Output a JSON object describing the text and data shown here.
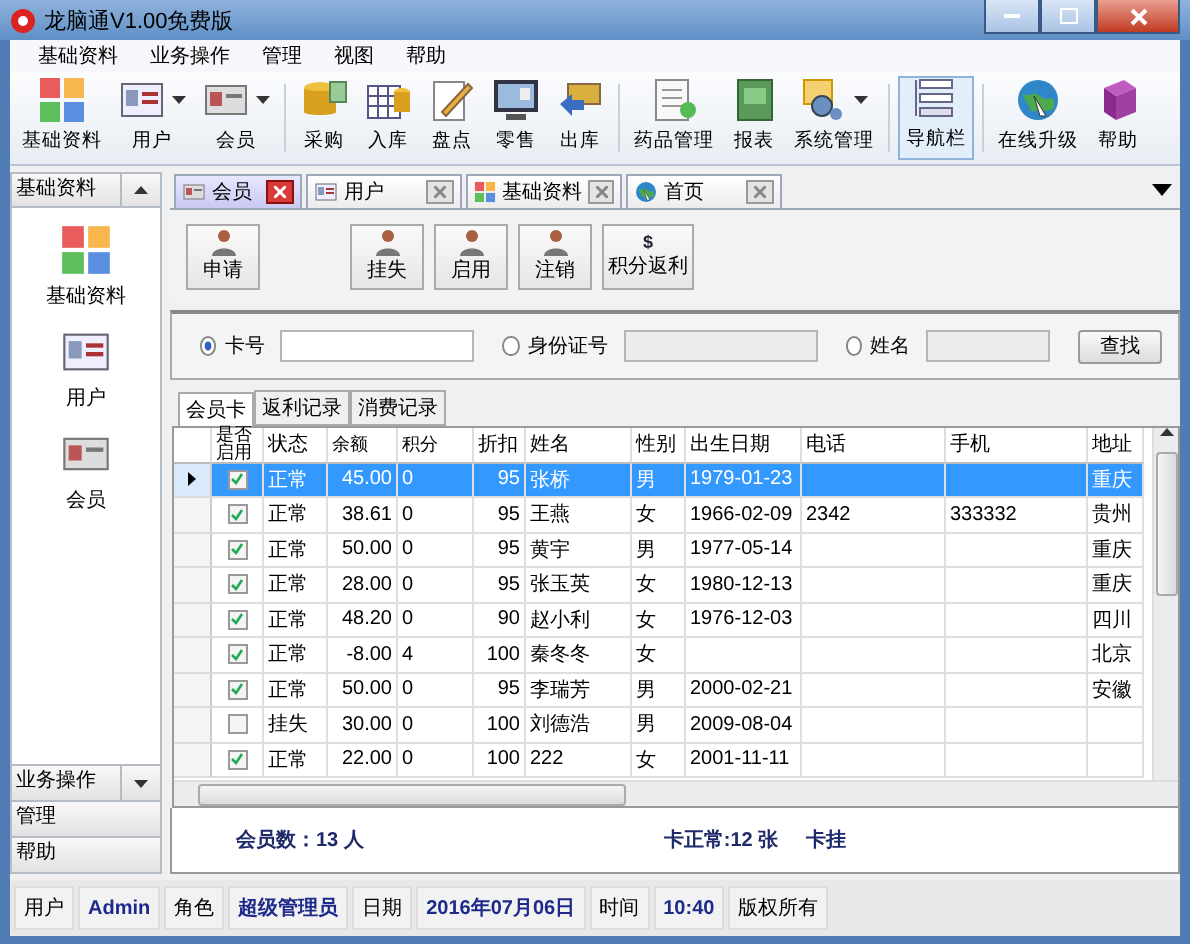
{
  "window": {
    "title": "龙脑通V1.00免费版"
  },
  "menu": [
    "基础资料",
    "业务操作",
    "管理",
    "视图",
    "帮助"
  ],
  "toolbar": [
    {
      "label": "基础资料",
      "dropdown": false,
      "selected": false
    },
    {
      "label": "用户",
      "dropdown": true,
      "selected": false
    },
    {
      "label": "会员",
      "dropdown": true,
      "selected": false
    },
    {
      "label": "采购",
      "dropdown": false,
      "selected": false
    },
    {
      "label": "入库",
      "dropdown": false,
      "selected": false
    },
    {
      "label": "盘点",
      "dropdown": false,
      "selected": false
    },
    {
      "label": "零售",
      "dropdown": false,
      "selected": false
    },
    {
      "label": "出库",
      "dropdown": false,
      "selected": false
    },
    {
      "label": "药品管理",
      "dropdown": false,
      "selected": false
    },
    {
      "label": "报表",
      "dropdown": false,
      "selected": false
    },
    {
      "label": "系统管理",
      "dropdown": true,
      "selected": false
    },
    {
      "label": "导航栏",
      "dropdown": false,
      "selected": true
    },
    {
      "label": "在线升级",
      "dropdown": false,
      "selected": false
    },
    {
      "label": "帮助",
      "dropdown": false,
      "selected": false
    }
  ],
  "sidebar": {
    "header": "基础资料",
    "items": [
      "基础资料",
      "用户",
      "会员"
    ],
    "sections": [
      {
        "label": "业务操作",
        "dropdown": true
      },
      {
        "label": "管理",
        "dropdown": false
      },
      {
        "label": "帮助",
        "dropdown": false
      }
    ]
  },
  "tabs": [
    {
      "label": "会员",
      "selected": true
    },
    {
      "label": "用户",
      "selected": false
    },
    {
      "label": "基础资料",
      "selected": false
    },
    {
      "label": "首页",
      "selected": false
    }
  ],
  "actions": [
    {
      "label": "申请"
    },
    {
      "label": "挂失"
    },
    {
      "label": "启用"
    },
    {
      "label": "注销"
    },
    {
      "label": "积分返利",
      "symbol": "$"
    }
  ],
  "search": {
    "options": [
      {
        "label": "卡号",
        "selected": true
      },
      {
        "label": "身份证号",
        "selected": false
      },
      {
        "label": "姓名",
        "selected": false
      }
    ],
    "button": "查找"
  },
  "subtabs": [
    {
      "label": "会员卡",
      "selected": true
    },
    {
      "label": "返利记录",
      "selected": false
    },
    {
      "label": "消费记录",
      "selected": false
    }
  ],
  "table": {
    "columns": [
      "",
      "是否启用",
      "状态",
      "余额",
      "积分",
      "折扣",
      "姓名",
      "性别",
      "出生日期",
      "电话",
      "手机",
      "地址"
    ],
    "rows": [
      {
        "selected": true,
        "enabled": true,
        "cells": [
          "",
          "",
          "正常",
          "45.00",
          "0",
          "95",
          "张桥",
          "男",
          "1979-01-23",
          "",
          "",
          "重庆"
        ]
      },
      {
        "selected": false,
        "enabled": true,
        "cells": [
          "",
          "",
          "正常",
          "38.61",
          "0",
          "95",
          "王燕",
          "女",
          "1966-02-09",
          "2342",
          "333332",
          "贵州"
        ]
      },
      {
        "selected": false,
        "enabled": true,
        "cells": [
          "",
          "",
          "正常",
          "50.00",
          "0",
          "95",
          "黄宇",
          "男",
          "1977-05-14",
          "",
          "",
          "重庆"
        ]
      },
      {
        "selected": false,
        "enabled": true,
        "cells": [
          "",
          "",
          "正常",
          "28.00",
          "0",
          "95",
          "张玉英",
          "女",
          "1980-12-13",
          "",
          "",
          "重庆"
        ]
      },
      {
        "selected": false,
        "enabled": true,
        "cells": [
          "",
          "",
          "正常",
          "48.20",
          "0",
          "90",
          "赵小利",
          "女",
          "1976-12-03",
          "",
          "",
          "四川"
        ]
      },
      {
        "selected": false,
        "enabled": true,
        "cells": [
          "",
          "",
          "正常",
          "-8.00",
          "4",
          "100",
          "秦冬冬",
          "女",
          "",
          "",
          "",
          "北京"
        ]
      },
      {
        "selected": false,
        "enabled": true,
        "cells": [
          "",
          "",
          "正常",
          "50.00",
          "0",
          "95",
          "李瑞芳",
          "男",
          "2000-02-21",
          "",
          "",
          "安徽"
        ]
      },
      {
        "selected": false,
        "enabled": false,
        "cells": [
          "",
          "",
          "挂失",
          "30.00",
          "0",
          "100",
          "刘德浩",
          "男",
          "2009-08-04",
          "",
          "",
          ""
        ]
      },
      {
        "selected": false,
        "enabled": true,
        "cells": [
          "",
          "",
          "正常",
          "22.00",
          "0",
          "100",
          "222",
          "女",
          "2001-11-11",
          "",
          "",
          ""
        ]
      }
    ]
  },
  "summary": [
    "会员数：13 人",
    "卡正常:12 张",
    "卡挂"
  ],
  "status_bar": [
    {
      "text": "用户",
      "kind": "label"
    },
    {
      "text": "Admin",
      "kind": "value"
    },
    {
      "text": "角色",
      "kind": "label"
    },
    {
      "text": "超级管理员",
      "kind": "value"
    },
    {
      "text": "日期",
      "kind": "label"
    },
    {
      "text": "2016年07月06日",
      "kind": "value"
    },
    {
      "text": "时间",
      "kind": "label"
    },
    {
      "text": "10:40",
      "kind": "value"
    },
    {
      "text": "版权所有",
      "kind": "label"
    }
  ]
}
